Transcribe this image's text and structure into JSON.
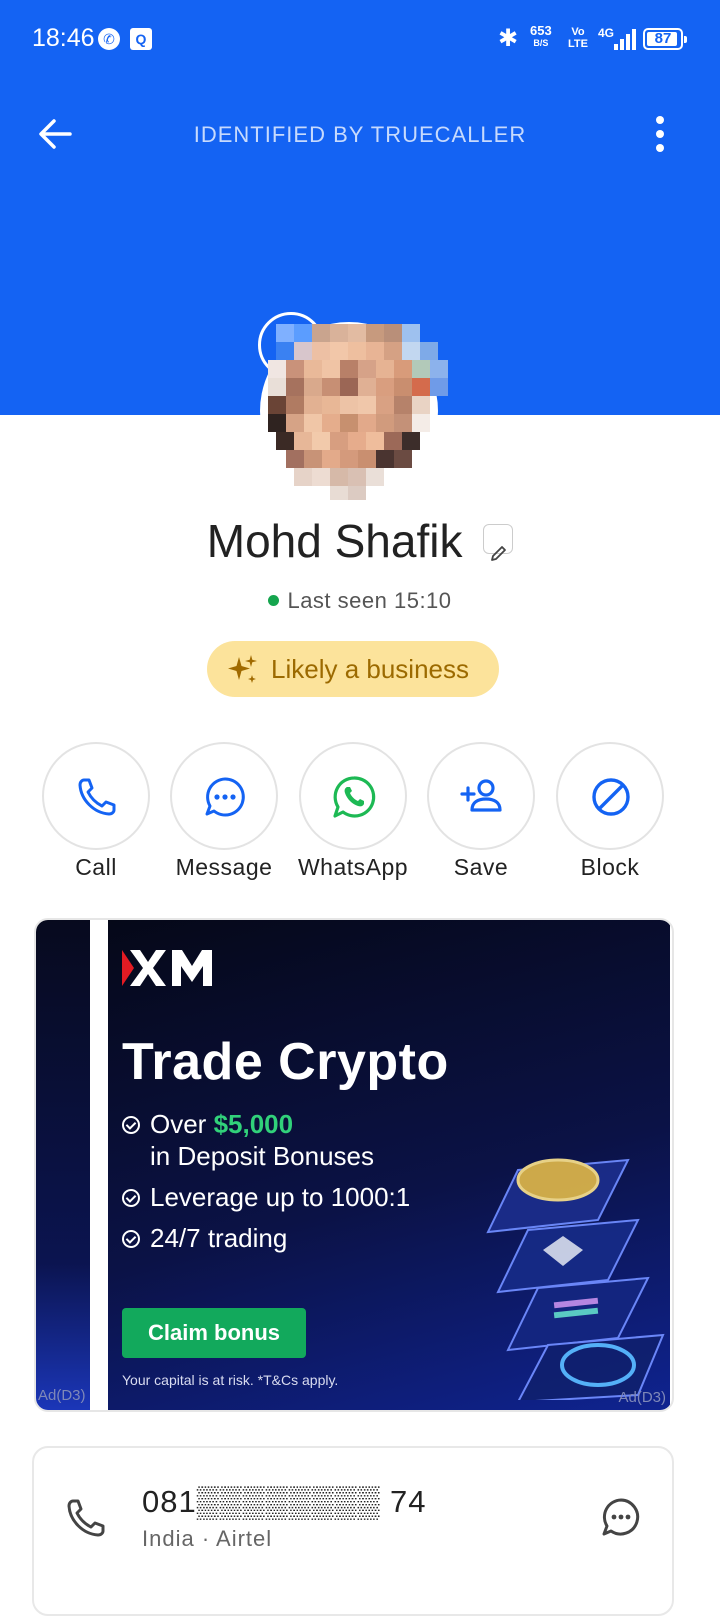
{
  "status_bar": {
    "time": "18:46",
    "net_speed": "653",
    "net_speed_unit": "B/S",
    "volte": "Vo\nLTE",
    "network": "4G",
    "battery": "87"
  },
  "header": {
    "title": "IDENTIFIED BY TRUECALLER",
    "bg_color": "#1463f3"
  },
  "contact": {
    "name": "Mohd Shafik",
    "last_seen": "Last seen 15:10",
    "badge": "Likely a business"
  },
  "actions": [
    {
      "label": "Call",
      "icon": "phone-icon"
    },
    {
      "label": "Message",
      "icon": "message-icon"
    },
    {
      "label": "WhatsApp",
      "icon": "whatsapp-icon"
    },
    {
      "label": "Save",
      "icon": "add-contact-icon"
    },
    {
      "label": "Block",
      "icon": "block-icon"
    }
  ],
  "ad": {
    "brand": "XM",
    "headline": "Trade Crypto",
    "bullet1_pre": "Over ",
    "bullet1_amount": "$5,000",
    "bullet1_line2": "in Deposit Bonuses",
    "bullet2": "Leverage up to 1000:1",
    "bullet3": "24/7 trading",
    "cta": "Claim bonus",
    "disclaimer": "Your capital is at risk. *T&Cs apply.",
    "label": "Ad(D3)",
    "left_label": "Ad(D3)"
  },
  "phone": {
    "number": "081▒▒▒▒▒▒▒▒ 74",
    "detail": "India · Airtel"
  }
}
